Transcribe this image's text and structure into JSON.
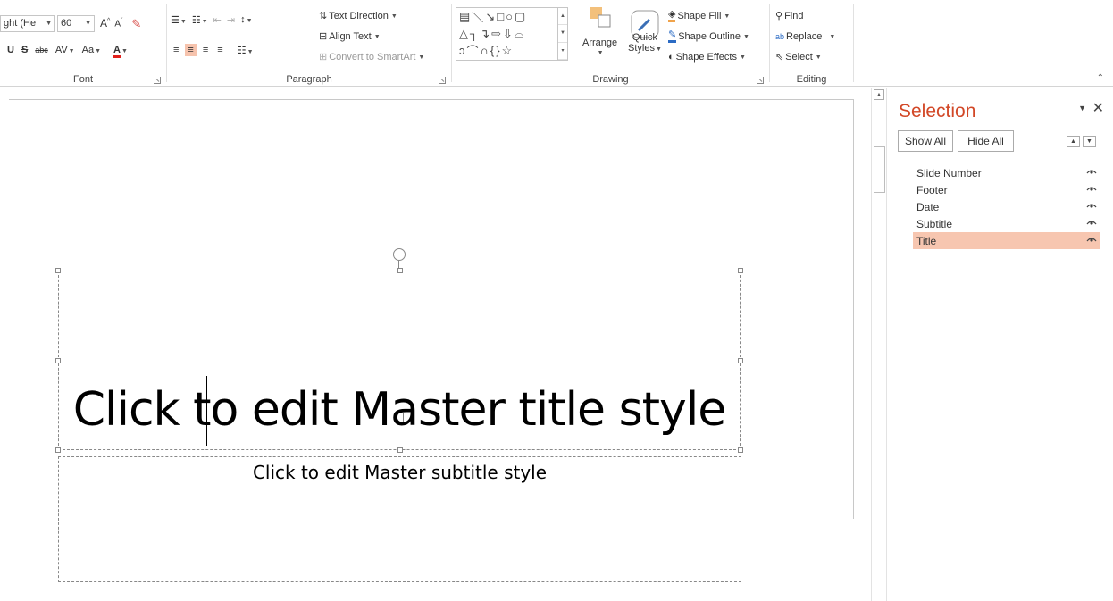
{
  "ribbon": {
    "font": {
      "font_name": "ght (He",
      "font_size": "60",
      "grow_icon": "A",
      "shrink_icon": "A",
      "underline": "U",
      "shadow": "S",
      "strike": "abc",
      "spacing": "AV",
      "case": "Aa",
      "color": "A",
      "label": "Font"
    },
    "paragraph": {
      "text_direction": "Text Direction",
      "align_text": "Align Text",
      "convert_smartart": "Convert to SmartArt",
      "label": "Paragraph"
    },
    "drawing": {
      "arrange": "Arrange",
      "quick_styles_1": "Quick",
      "quick_styles_2": "Styles",
      "shape_fill": "Shape Fill",
      "shape_outline": "Shape Outline",
      "shape_effects": "Shape Effects",
      "label": "Drawing"
    },
    "editing": {
      "find": "Find",
      "replace": "Replace",
      "select": "Select",
      "label": "Editing"
    }
  },
  "slide": {
    "title_placeholder": "Click to edit Master title style",
    "subtitle_placeholder": "Click to edit Master subtitle style"
  },
  "selection_pane": {
    "title": "Selection",
    "show_all": "Show All",
    "hide_all": "Hide All",
    "items": [
      {
        "label": "Slide Number",
        "selected": false
      },
      {
        "label": "Footer",
        "selected": false
      },
      {
        "label": "Date",
        "selected": false
      },
      {
        "label": "Subtitle",
        "selected": false
      },
      {
        "label": "Title",
        "selected": true
      }
    ]
  },
  "colors": {
    "accent": "#d24726",
    "selected_row": "#f7c6b0",
    "align_center_highlight": "#f6c3ad"
  }
}
